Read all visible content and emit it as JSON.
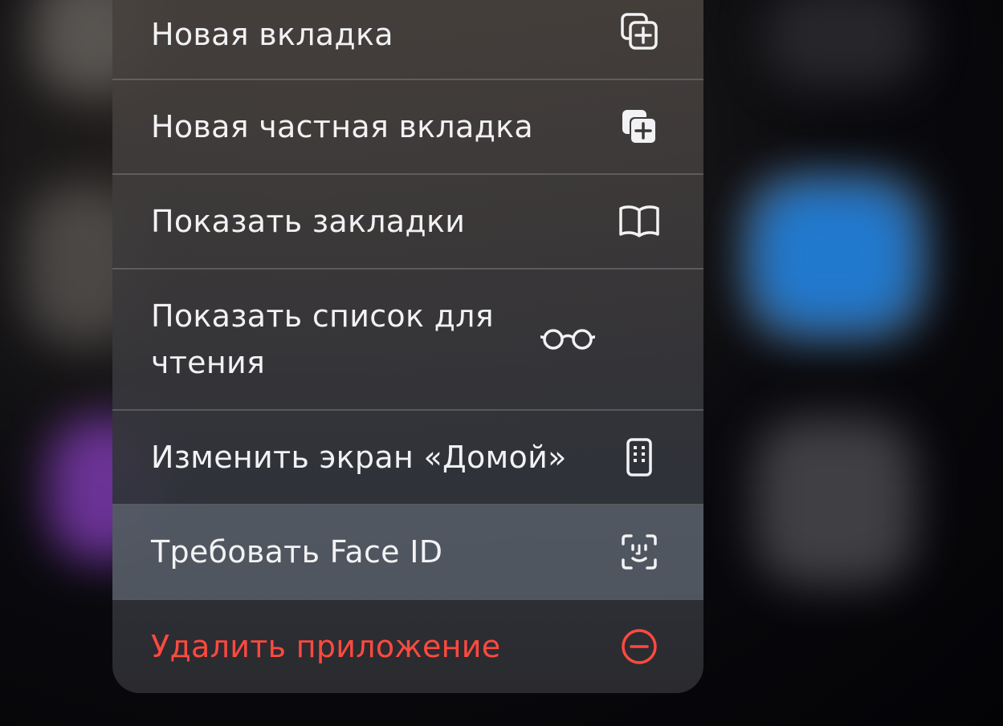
{
  "menu": {
    "items": [
      {
        "label": "Новая вкладка",
        "icon": "new-tab-icon"
      },
      {
        "label": "Новая частная вкладка",
        "icon": "new-private-tab-icon"
      },
      {
        "label": "Показать закладки",
        "icon": "book-icon"
      },
      {
        "label": "Показать список для чтения",
        "icon": "glasses-icon"
      },
      {
        "label": "Изменить экран «Домой»",
        "icon": "phone-apps-icon"
      },
      {
        "label": "Требовать Face ID",
        "icon": "face-id-icon"
      },
      {
        "label": "Удалить приложение",
        "icon": "minus-circle-icon",
        "color": "#ff4a3f"
      }
    ]
  },
  "colors": {
    "destructive": "#ff4a3f",
    "text": "#f2f2f4",
    "highlight_row": "#6e7682"
  }
}
